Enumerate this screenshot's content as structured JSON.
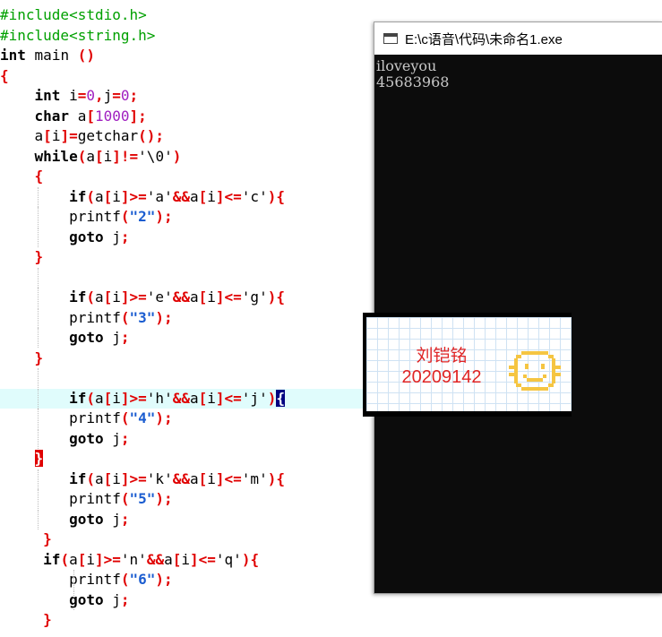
{
  "editor": {
    "lines": [
      "#include<stdio.h>",
      "#include<string.h>",
      "int main ()",
      "{",
      "    int i=0,j=0;",
      "    char a[1000];",
      "    a[i]=getchar();",
      "    while(a[i]!='\\0')",
      "    {",
      "        if(a[i]>='a'&&a[i]<='c'){",
      "        printf(\"2\");",
      "        goto j;",
      "    }",
      "",
      "",
      "        if(a[i]>='e'&&a[i]<='g'){",
      "        printf(\"3\");",
      "        goto j;",
      "    }",
      "",
      "        if(a[i]>='h'&&a[i]<='j'){",
      "        printf(\"4\");",
      "        goto j;",
      "    }",
      "        if(a[i]>='k'&&a[i]<='m'){",
      "        printf(\"5\");",
      "        goto j;",
      "     }",
      "     if(a[i]>='n'&&a[i]<='q'){",
      "        printf(\"6\");",
      "        goto j;",
      "     }"
    ],
    "highlighted_line": 20,
    "cursor_bracket": "{"
  },
  "console": {
    "title": "E:\\c语音\\代码\\未命名1.exe",
    "output": [
      "iloveyou",
      "45683968"
    ]
  },
  "badge": {
    "name": "刘铠铭",
    "id": "20209142"
  },
  "colors": {
    "preprocessor": "#00a000",
    "operator": "#e00000",
    "number": "#a020c0",
    "string": "#1a5cd0",
    "highlight": "#e0fcfc",
    "badge_text": "#e02424",
    "smiley": "#f5c542"
  }
}
